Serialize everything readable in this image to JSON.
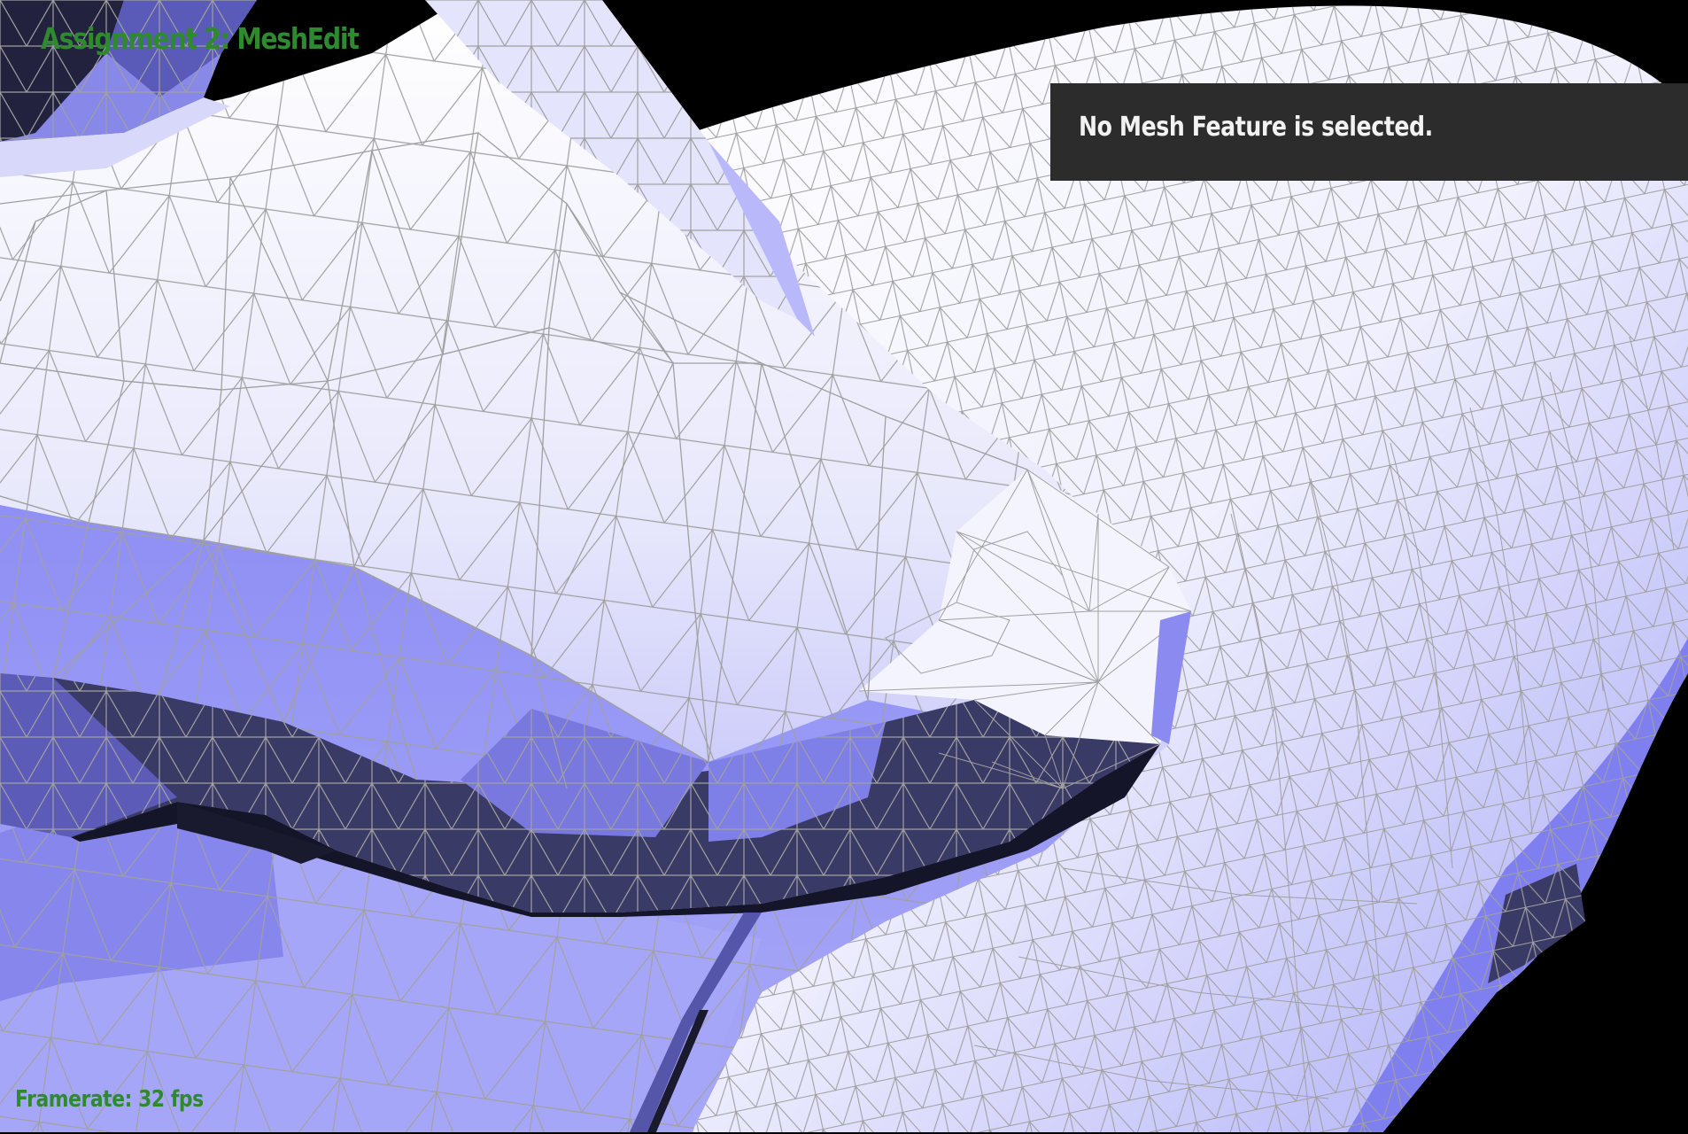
{
  "app": {
    "title": "Assignment 2: MeshEdit"
  },
  "selection_panel": {
    "message": "No Mesh Feature is selected."
  },
  "status": {
    "framerate_label": "Framerate: 32 fps"
  },
  "colors": {
    "background": "#000000",
    "mesh_light": "#ffffff",
    "mesh_mid": "#9b9bf7",
    "mesh_dark": "#1a1a2e",
    "wireframe": "#a0a0a0",
    "title_green": "#2f8a2f",
    "panel_bg": "#2c2c2c",
    "panel_text": "#f2f2f2"
  }
}
